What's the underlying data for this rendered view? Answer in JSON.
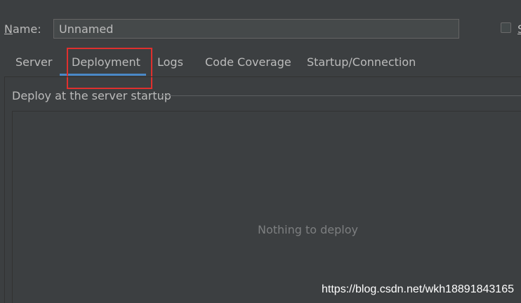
{
  "name_field": {
    "label_mnemonic": "N",
    "label_rest": "ame:",
    "value": "Unnamed"
  },
  "share_checkbox": {
    "label": "S",
    "checked": false
  },
  "tabs": [
    {
      "label": "Server",
      "active": false
    },
    {
      "label": "Deployment",
      "active": true
    },
    {
      "label": "Logs",
      "active": false
    },
    {
      "label": "Code Coverage",
      "active": false
    },
    {
      "label": "Startup/Connection",
      "active": false
    }
  ],
  "deploy_section": {
    "title": "Deploy at the server startup",
    "empty_text": "Nothing to deploy"
  },
  "watermark": "https://blog.csdn.net/wkh18891843165",
  "colors": {
    "background": "#3c3f41",
    "text": "#bbbbbb",
    "active_tab_underline": "#4a88c7",
    "highlight_box": "#e0302e"
  }
}
